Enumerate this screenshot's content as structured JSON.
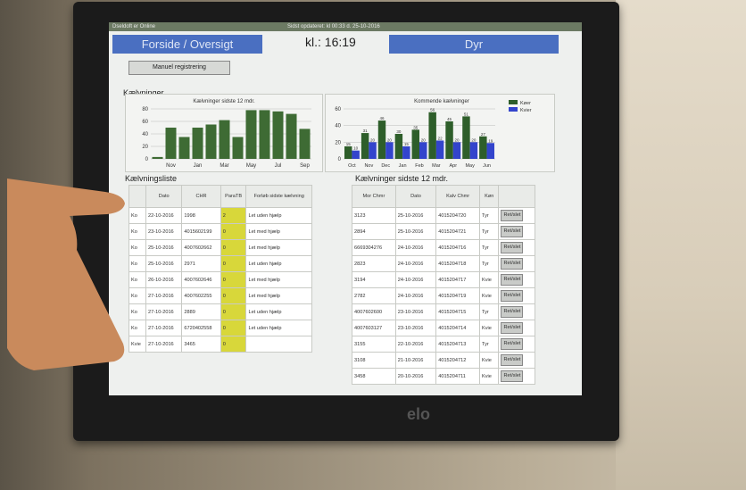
{
  "titlebar": {
    "left": "Dseldoft er Online",
    "right": "Sidst opdateret: kl 00:33 d. 25-10-2016"
  },
  "header": {
    "left_tab": "Forside / Oversigt",
    "clock": "kl.: 16:19",
    "right_tab": "Dyr"
  },
  "buttons": {
    "manual": "Manuel registrering"
  },
  "sections": {
    "kaelvninger": "Kælvninger",
    "kaelvningsliste": "Kælvningsliste",
    "sidste12": "Kælvninger sidste 12 mdr."
  },
  "chart_data": [
    {
      "type": "bar",
      "title": "Kælvninger sidste 12 mdr.",
      "categories": [
        "",
        "Nov",
        "",
        "Jan",
        "",
        "Mar",
        "",
        "May",
        "",
        "Jul",
        "",
        "Sep"
      ],
      "values": [
        3,
        50,
        35,
        50,
        55,
        62,
        35,
        78,
        78,
        76,
        72,
        48
      ],
      "ylim": [
        0,
        80
      ],
      "yticks": [
        "0",
        "20",
        "40",
        "60",
        "80"
      ],
      "color": "#3e6b34"
    },
    {
      "type": "bar",
      "title": "Kommende kælvninger",
      "categories": [
        "Oct",
        "Nov",
        "Dec",
        "Jan",
        "Feb",
        "Mar",
        "Apr",
        "May",
        "Jun"
      ],
      "series": [
        {
          "name": "Køer",
          "values": [
            15,
            31,
            46,
            30,
            35,
            56,
            45,
            51,
            27
          ],
          "color": "#2e5e2a"
        },
        {
          "name": "Kvier",
          "values": [
            10,
            20,
            20,
            15,
            20,
            22,
            20,
            20,
            19
          ],
          "color": "#3344cc"
        }
      ],
      "ylim": [
        0,
        60
      ],
      "yticks": [
        "0",
        "20",
        "40",
        "60"
      ],
      "legend_position": "top-right"
    }
  ],
  "left_table": {
    "headers": [
      "",
      "Dato",
      "CHR",
      "ParaTB",
      "Forløb sidste kælvning"
    ],
    "rows": [
      [
        "Ko",
        "22-10-2016",
        "1998",
        "2",
        "Let uden hjælp"
      ],
      [
        "Ko",
        "23-10-2016",
        "4015602199",
        "0",
        "Let med hjælp"
      ],
      [
        "Ko",
        "25-10-2016",
        "4007602662",
        "0",
        "Let med hjælp"
      ],
      [
        "Ko",
        "25-10-2016",
        "2971",
        "0",
        "Let uden hjælp"
      ],
      [
        "Ko",
        "26-10-2016",
        "4007602646",
        "0",
        "Let med hjælp"
      ],
      [
        "Ko",
        "27-10-2016",
        "4007602255",
        "0",
        "Let med hjælp"
      ],
      [
        "Ko",
        "27-10-2016",
        "2889",
        "0",
        "Let uden hjælp"
      ],
      [
        "Ko",
        "27-10-2016",
        "6720402558",
        "0",
        "Let uden hjælp"
      ],
      [
        "Kvie",
        "27-10-2016",
        "3465",
        "0",
        ""
      ]
    ]
  },
  "right_table": {
    "headers": [
      "Mor Chmr",
      "Dato",
      "Kalv Chmr",
      "Køn",
      ""
    ],
    "rows": [
      [
        "3123",
        "25-10-2016",
        "4015204720",
        "Tyr",
        "Ret/slet"
      ],
      [
        "2894",
        "25-10-2016",
        "4015204721",
        "Tyr",
        "Ret/slet"
      ],
      [
        "6669304276",
        "24-10-2016",
        "4015204716",
        "Tyr",
        "Ret/slet"
      ],
      [
        "2823",
        "24-10-2016",
        "4015204718",
        "Tyr",
        "Ret/slet"
      ],
      [
        "3194",
        "24-10-2016",
        "4015204717",
        "Kvie",
        "Ret/slet"
      ],
      [
        "2782",
        "24-10-2016",
        "4015204719",
        "Kvie",
        "Ret/slet"
      ],
      [
        "4007602600",
        "23-10-2016",
        "4015204715",
        "Tyr",
        "Ret/slet"
      ],
      [
        "4007603127",
        "23-10-2016",
        "4015204714",
        "Kvie",
        "Ret/slet"
      ],
      [
        "3155",
        "22-10-2016",
        "4015204713",
        "Tyr",
        "Ret/slet"
      ],
      [
        "3108",
        "21-10-2016",
        "4015204712",
        "Kvie",
        "Ret/slet"
      ],
      [
        "3458",
        "20-10-2016",
        "4015204711",
        "Kvie",
        "Ret/slet"
      ]
    ]
  },
  "bezel_logo": "elo"
}
